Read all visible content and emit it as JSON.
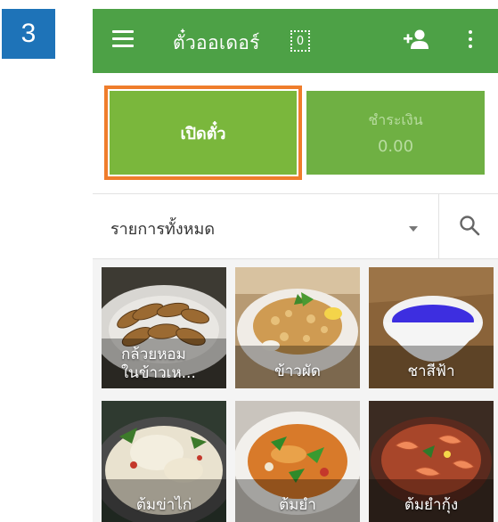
{
  "step_number": "3",
  "appbar": {
    "title": "ตั๋วออเดอร์",
    "ticket_count": "0",
    "icons": [
      "menu-icon",
      "add-user-icon",
      "more-vert-icon"
    ]
  },
  "ticket_panel": {
    "open_ticket_label": "เปิดตั๋ว",
    "charge_label": "ชำระเงิน",
    "charge_amount": "0.00"
  },
  "filter": {
    "selected": "รายการทั้งหมด",
    "icons": [
      "dropdown-arrow-icon",
      "search-icon"
    ]
  },
  "items": [
    {
      "name": "กล้วยหอม\nในข้าวเห..."
    },
    {
      "name": "ข้าวผัด"
    },
    {
      "name": "ชาสีฟ้า"
    },
    {
      "name": "ต้มข่าไก่"
    },
    {
      "name": "ต้มยำ"
    },
    {
      "name": "ต้มยำกุ้ง"
    }
  ],
  "colors": {
    "appbar": "#4da146",
    "open_ticket": "#7ab73c",
    "charge": "#6fb043",
    "highlight": "#ef7d2c",
    "step_badge": "#1e73b8"
  }
}
